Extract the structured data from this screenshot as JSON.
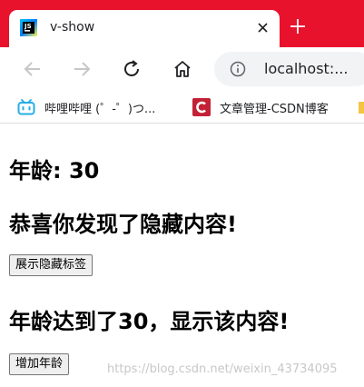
{
  "browser": {
    "tab_title": "v-show",
    "url": "localhost:...",
    "bookmarks": [
      {
        "label": "哔哩哔哩 (゜-゜)つ..."
      },
      {
        "label": "文章管理-CSDN博客"
      }
    ],
    "colors": {
      "tabstrip": "#e8122d",
      "bilibili": "#23ade5",
      "csdn": "#c32136"
    }
  },
  "page": {
    "age_heading": "年龄: 30",
    "hidden_heading": "恭喜你发现了隐藏内容!",
    "show_hidden_button": "展示隐藏标签",
    "age_reached_heading": "年龄达到了30，显示该内容!",
    "add_age_button": "增加年龄"
  },
  "watermark": "https://blog.csdn.net/weixin_43734095"
}
